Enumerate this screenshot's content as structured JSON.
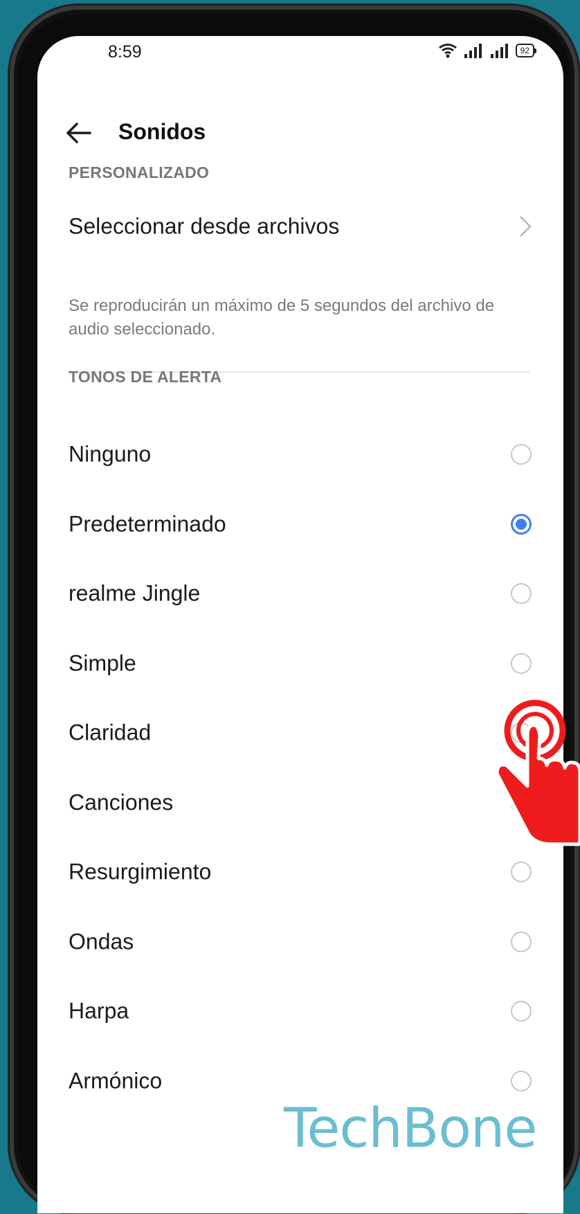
{
  "status_bar": {
    "time": "8:59",
    "battery": "92"
  },
  "header": {
    "title": "Sonidos"
  },
  "custom_section": {
    "title": "PERSONALIZADO",
    "select_files_label": "Seleccionar desde archivos",
    "hint": "Se reproducirán un máximo de 5 segundos del archivo de audio seleccionado."
  },
  "alert_section": {
    "title": "TONOS DE ALERTA",
    "items": [
      {
        "label": "Ninguno",
        "checked": false
      },
      {
        "label": "Predeterminado",
        "checked": true
      },
      {
        "label": "realme Jingle",
        "checked": false
      },
      {
        "label": "Simple",
        "checked": false
      },
      {
        "label": "Claridad",
        "checked": false
      },
      {
        "label": "Canciones",
        "checked": false
      },
      {
        "label": "Resurgimiento",
        "checked": false
      },
      {
        "label": "Ondas",
        "checked": false
      },
      {
        "label": "Harpa",
        "checked": false
      },
      {
        "label": "Armónico",
        "checked": false
      }
    ]
  },
  "watermark": "TechBone",
  "colors": {
    "accent": "#3f7ff5",
    "background": "#17798a",
    "cursor": "#ee1c1c"
  }
}
